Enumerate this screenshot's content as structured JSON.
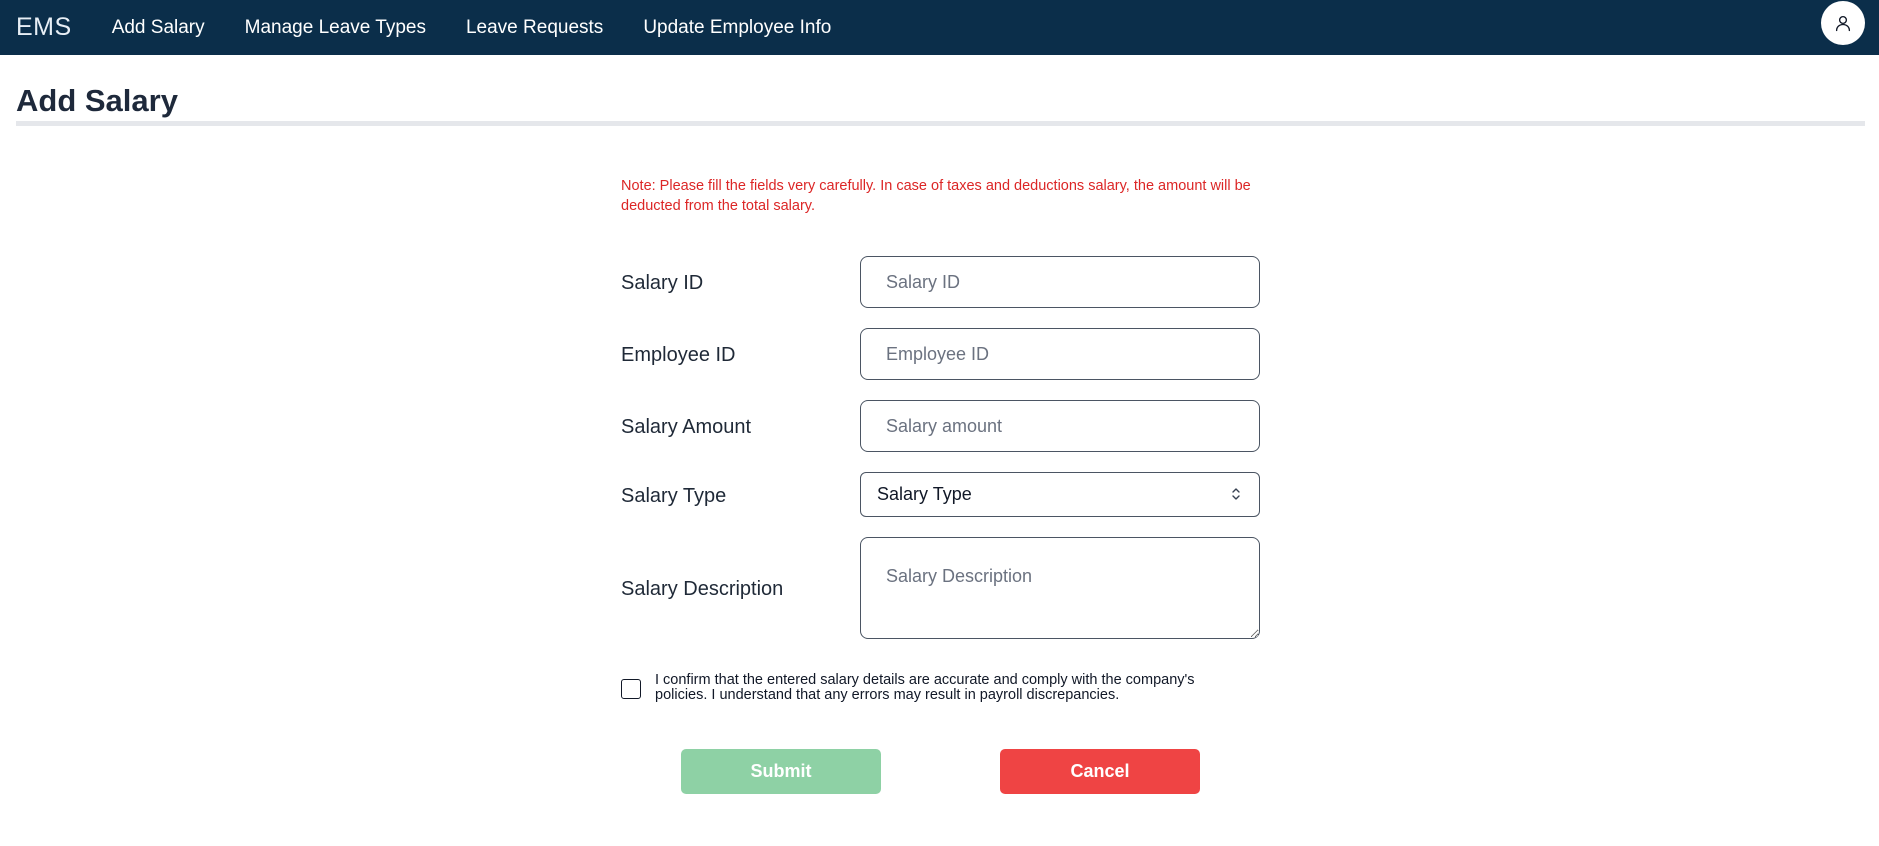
{
  "navbar": {
    "brand": "EMS",
    "items": [
      "Add Salary",
      "Manage Leave Types",
      "Leave Requests",
      "Update Employee Info"
    ],
    "avatar_icon": "user-icon"
  },
  "page": {
    "title": "Add Salary"
  },
  "form": {
    "note": "Note: Please fill the fields very carefully. In case of taxes and deductions salary, the amount will be deducted from the total salary.",
    "fields": {
      "salary_id": {
        "label": "Salary ID",
        "placeholder": "Salary ID",
        "value": ""
      },
      "employee_id": {
        "label": "Employee ID",
        "placeholder": "Employee ID",
        "value": ""
      },
      "salary_amount": {
        "label": "Salary Amount",
        "placeholder": "Salary amount",
        "value": ""
      },
      "salary_type": {
        "label": "Salary Type",
        "selected": "Salary Type"
      },
      "salary_description": {
        "label": "Salary Description",
        "placeholder": "Salary Description",
        "value": ""
      }
    },
    "confirm_text": "I confirm that the entered salary details are accurate and comply with the company's policies. I understand that any errors may result in payroll discrepancies.",
    "confirm_checked": false,
    "submit_label": "Submit",
    "cancel_label": "Cancel"
  },
  "colors": {
    "navbar": "#0b2e4a",
    "note": "#dc2626",
    "submit": "#8ed1a5",
    "cancel": "#ef4444"
  }
}
